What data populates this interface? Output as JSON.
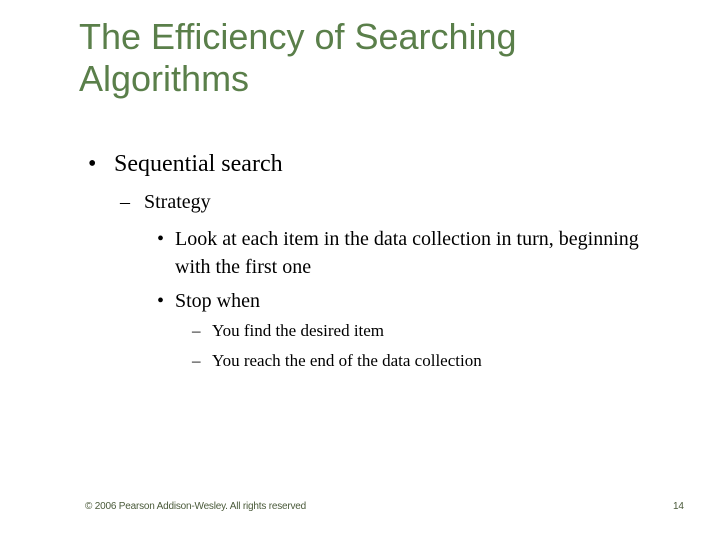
{
  "slide": {
    "title": "The Efficiency of Searching Algorithms",
    "title_color": "#5a7f4a",
    "bullets": {
      "level1": {
        "marker": "•",
        "text": "Sequential search"
      },
      "level2": {
        "marker": "–",
        "text": "Strategy"
      },
      "level3": [
        {
          "marker": "•",
          "text": "Look at each item in the data collection in turn, beginning with the first one"
        },
        {
          "marker": "•",
          "text": "Stop when"
        }
      ],
      "level4": [
        {
          "marker": "–",
          "text": "You find the desired item"
        },
        {
          "marker": "–",
          "text": "You reach the end of the data collection"
        }
      ]
    },
    "footer": {
      "copyright": "© 2006 Pearson Addison-Wesley. All rights reserved",
      "page_number": "14"
    }
  }
}
